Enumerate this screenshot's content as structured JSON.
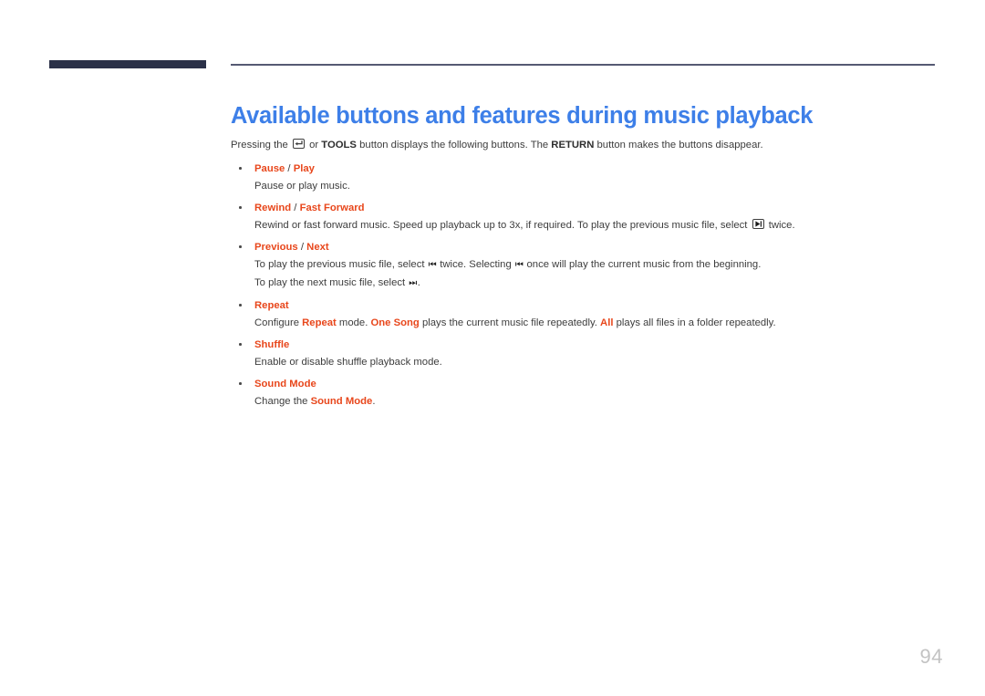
{
  "header": {
    "accent_bar_color": "#2b3148",
    "rule_color": "#555a73",
    "title": "Available buttons and features during music playback",
    "title_color": "#3d7fe8"
  },
  "intro": {
    "before_icon": "Pressing the ",
    "enter_icon": "enter-key-icon",
    "after_icon": " or ",
    "tools_label": "TOOLS",
    "middle": " button displays the following buttons. The ",
    "return_label": "RETURN",
    "tail": " button makes the buttons disappear."
  },
  "items": [
    {
      "title_primary": "Pause",
      "title_separator": " / ",
      "title_secondary": "Play",
      "lines": [
        {
          "text": "Pause or play music."
        }
      ]
    },
    {
      "title_primary": "Rewind",
      "title_separator": " / ",
      "title_secondary": "Fast Forward",
      "lines": [
        {
          "prefix": "Rewind or fast forward music. Speed up playback up to 3x, if required. To play the previous music file, select ",
          "icon": "fast-forward-key-icon",
          "suffix": " twice."
        }
      ]
    },
    {
      "title_primary": "Previous",
      "title_separator": " / ",
      "title_secondary": "Next",
      "lines": [
        {
          "prefix": "To play the previous music file, select ",
          "glyph1": "⏮",
          "mid": " twice. Selecting ",
          "glyph2": "⏮",
          "suffix": " once will play the current music from the beginning."
        },
        {
          "prefix": "To play the next music file, select ",
          "glyph1": "⏭",
          "suffix": "."
        }
      ]
    },
    {
      "title_primary": "Repeat",
      "title_separator": "",
      "title_secondary": "",
      "lines": [
        {
          "p1": "Configure ",
          "h1": "Repeat",
          "p2": " mode. ",
          "h2": "One Song",
          "p3": " plays the current music file repeatedly. ",
          "h3": "All",
          "p4": " plays all files in a folder repeatedly."
        }
      ]
    },
    {
      "title_primary": "Shuffle",
      "title_separator": "",
      "title_secondary": "",
      "lines": [
        {
          "text": "Enable or disable shuffle playback mode."
        }
      ]
    },
    {
      "title_primary": "Sound Mode",
      "title_separator": "",
      "title_secondary": "",
      "lines": [
        {
          "p1": "Change the ",
          "h1": "Sound Mode",
          "p2": "."
        }
      ]
    }
  ],
  "footer": {
    "page_number": "94"
  }
}
